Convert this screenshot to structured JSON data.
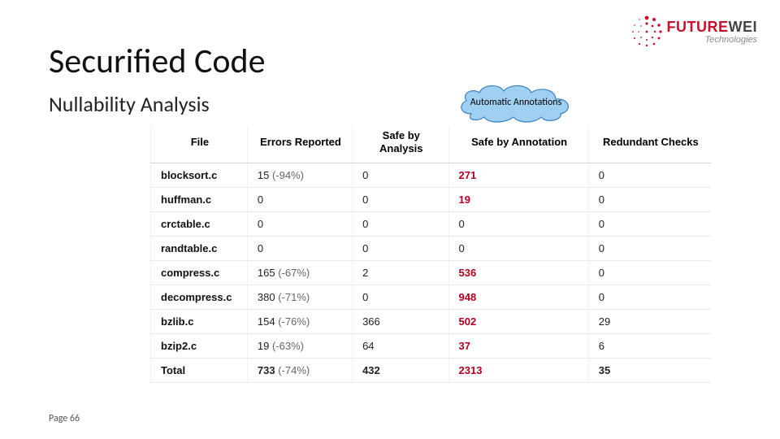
{
  "logo": {
    "part1": "FUTURE",
    "part2": "WEI",
    "sub": "Technologies"
  },
  "title": "Securified Code",
  "subtitle": "Nullability Analysis",
  "cloud_label": "Automatic Annotations",
  "table": {
    "headers": {
      "file": "File",
      "errors": "Errors Reported",
      "safe_analysis": "Safe by Analysis",
      "safe_annotation": "Safe by Annotation",
      "redundant": "Redundant Checks"
    },
    "rows": [
      {
        "file": "blocksort.c",
        "errors_val": "15",
        "errors_pct": "(-94%)",
        "safe_analysis": "0",
        "safe_annotation": "271",
        "hl_annot": true,
        "redundant": "0"
      },
      {
        "file": "huffman.c",
        "errors_val": "0",
        "errors_pct": "",
        "safe_analysis": "0",
        "safe_annotation": "19",
        "hl_annot": true,
        "redundant": "0"
      },
      {
        "file": "crctable.c",
        "errors_val": "0",
        "errors_pct": "",
        "safe_analysis": "0",
        "safe_annotation": "0",
        "hl_annot": false,
        "redundant": "0"
      },
      {
        "file": "randtable.c",
        "errors_val": "0",
        "errors_pct": "",
        "safe_analysis": "0",
        "safe_annotation": "0",
        "hl_annot": false,
        "redundant": "0"
      },
      {
        "file": "compress.c",
        "errors_val": "165",
        "errors_pct": "(-67%)",
        "safe_analysis": "2",
        "safe_annotation": "536",
        "hl_annot": true,
        "redundant": "0"
      },
      {
        "file": "decompress.c",
        "errors_val": "380",
        "errors_pct": "(-71%)",
        "safe_analysis": "0",
        "safe_annotation": "948",
        "hl_annot": true,
        "redundant": "0"
      },
      {
        "file": "bzlib.c",
        "errors_val": "154",
        "errors_pct": "(-76%)",
        "safe_analysis": "366",
        "safe_annotation": "502",
        "hl_annot": true,
        "redundant": "29"
      },
      {
        "file": "bzip2.c",
        "errors_val": "19",
        "errors_pct": "(-63%)",
        "safe_analysis": "64",
        "safe_annotation": "37",
        "hl_annot": true,
        "redundant": "6"
      }
    ],
    "total": {
      "file": "Total",
      "errors_val": "733",
      "errors_pct": "(-74%)",
      "safe_analysis": "432",
      "safe_annotation": "2313",
      "redundant": "35"
    }
  },
  "footer": "Page 66"
}
